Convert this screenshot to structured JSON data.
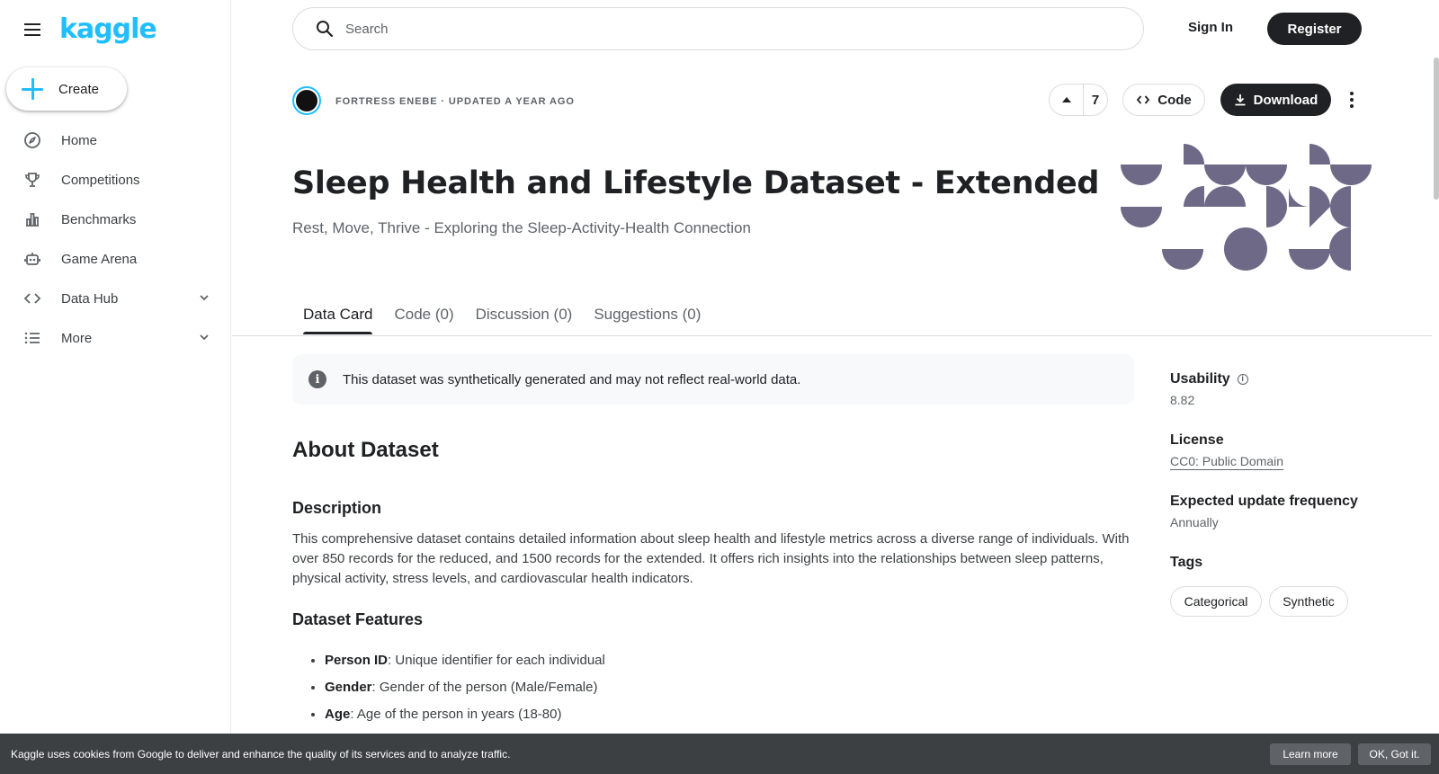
{
  "sidebar": {
    "logo": "kaggle",
    "create_label": "Create",
    "items": [
      {
        "label": "Home",
        "icon": "compass-icon"
      },
      {
        "label": "Competitions",
        "icon": "trophy-icon"
      },
      {
        "label": "Benchmarks",
        "icon": "bar-chart-icon"
      },
      {
        "label": "Game Arena",
        "icon": "robot-icon"
      },
      {
        "label": "Data Hub",
        "icon": "code-icon"
      },
      {
        "label": "More",
        "icon": "list-icon"
      }
    ]
  },
  "topbar": {
    "search_placeholder": "Search",
    "signin_label": "Sign In",
    "register_label": "Register"
  },
  "dataset": {
    "byline": "FORTRESS ENEBE · UPDATED A YEAR AGO",
    "upvotes": "7",
    "code_label": "Code",
    "download_label": "Download",
    "title": "Sleep Health and Lifestyle Dataset - Extended",
    "subtitle": "Rest, Move, Thrive - Exploring the Sleep-Activity-Health Connection"
  },
  "tabs": [
    {
      "label": "Data Card",
      "active": true
    },
    {
      "label": "Code (0)",
      "active": false
    },
    {
      "label": "Discussion (0)",
      "active": false
    },
    {
      "label": "Suggestions (0)",
      "active": false
    }
  ],
  "content": {
    "notice": "This dataset was synthetically generated and may not reflect real-world data.",
    "about_heading": "About Dataset",
    "description_heading": "Description",
    "description": "This comprehensive dataset contains detailed information about sleep health and lifestyle metrics across a diverse range of individuals. With over 850 records for the reduced, and 1500 records for the extended. It offers rich insights into the relationships between sleep patterns, physical activity, stress levels, and cardiovascular health indicators.",
    "features_heading": "Dataset Features",
    "features": [
      {
        "name": "Person ID",
        "desc": ": Unique identifier for each individual"
      },
      {
        "name": "Gender",
        "desc": ": Gender of the person (Male/Female)"
      },
      {
        "name": "Age",
        "desc": ": Age of the person in years (18-80)"
      }
    ]
  },
  "meta": {
    "usability_label": "Usability",
    "usability_value": "8.82",
    "license_label": "License",
    "license_value": "CC0: Public Domain",
    "frequency_label": "Expected update frequency",
    "frequency_value": "Annually",
    "tags_label": "Tags",
    "tags": [
      "Categorical",
      "Synthetic"
    ]
  },
  "cookie": {
    "text": "Kaggle uses cookies from Google to deliver and enhance the quality of its services and to analyze traffic.",
    "learn_more": "Learn more",
    "ok": "OK, Got it."
  },
  "colors": {
    "brand": "#20beff",
    "hero": "#6d6987",
    "dark": "#202124"
  }
}
